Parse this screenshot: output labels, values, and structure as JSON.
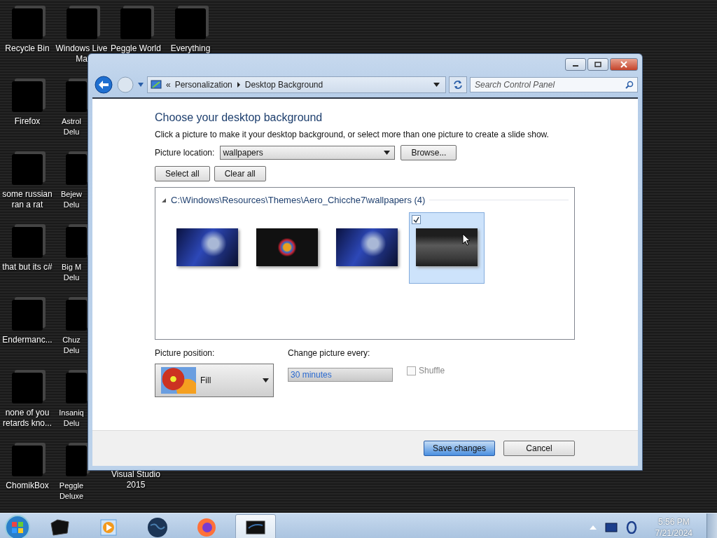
{
  "desktop": {
    "columns": [
      {
        "items": [
          {
            "label": "Recycle Bin"
          },
          {
            "label": "Firefox"
          },
          {
            "label": "some russian ran a rat"
          },
          {
            "label": "that but its c#"
          },
          {
            "label": "Endermanc..."
          },
          {
            "label": "none of you retards kno..."
          },
          {
            "label": "ChomikBox"
          }
        ]
      },
      {
        "items": [
          {
            "label": "Windows Live Ma"
          },
          {
            "label": "Astrol Delu"
          },
          {
            "label": "Bejew Delu"
          },
          {
            "label": "Big M Delu"
          },
          {
            "label": "Chuz Delu"
          },
          {
            "label": "Insaniq Delu"
          },
          {
            "label": "Peggle Deluxe"
          }
        ]
      },
      {
        "items": [
          {
            "label": "Peggle World"
          },
          {
            "label": "Visual Studio 2015",
            "covered": true
          }
        ]
      },
      {
        "items": [
          {
            "label": "Everything"
          }
        ]
      }
    ]
  },
  "window": {
    "breadcrumb": [
      "Personalization",
      "Desktop Background"
    ],
    "breadcrumb_prefix": "«",
    "search": {
      "placeholder": "Search Control Panel"
    },
    "heading": "Choose your desktop background",
    "description": "Click a picture to make it your desktop background, or select more than one picture to create a slide show.",
    "picture_location": {
      "label": "Picture location:",
      "value": "wallpapers",
      "browse": "Browse..."
    },
    "select_buttons": [
      "Select all",
      "Clear all"
    ],
    "folder": {
      "path": "C:\\Windows\\Resources\\Themes\\Aero_Chicche7\\wallpapers (4)",
      "expanded": true,
      "pictures": [
        {
          "kind": "blue",
          "selected": false,
          "checked": false
        },
        {
          "kind": "swirl",
          "selected": false,
          "checked": false
        },
        {
          "kind": "blue",
          "selected": false,
          "checked": false
        },
        {
          "kind": "grey",
          "selected": true,
          "checked": true
        }
      ]
    },
    "picture_position": {
      "label": "Picture position:",
      "value": "Fill"
    },
    "change_every": {
      "label": "Change picture every:",
      "value": "30 minutes",
      "disabled": true
    },
    "shuffle": {
      "label": "Shuffle",
      "checked": false,
      "disabled": true
    },
    "buttons": [
      {
        "label": "Save changes",
        "default": true
      },
      {
        "label": "Cancel",
        "default": false
      }
    ]
  },
  "taskbar": {
    "apps": [
      {
        "kind": "box",
        "selected": false
      },
      {
        "kind": "player",
        "selected": false
      },
      {
        "kind": "globe",
        "selected": false
      },
      {
        "kind": "firefox",
        "selected": false
      },
      {
        "kind": "screen",
        "selected": true
      }
    ],
    "time": "5:56 PM",
    "date": "7/21/2024"
  }
}
